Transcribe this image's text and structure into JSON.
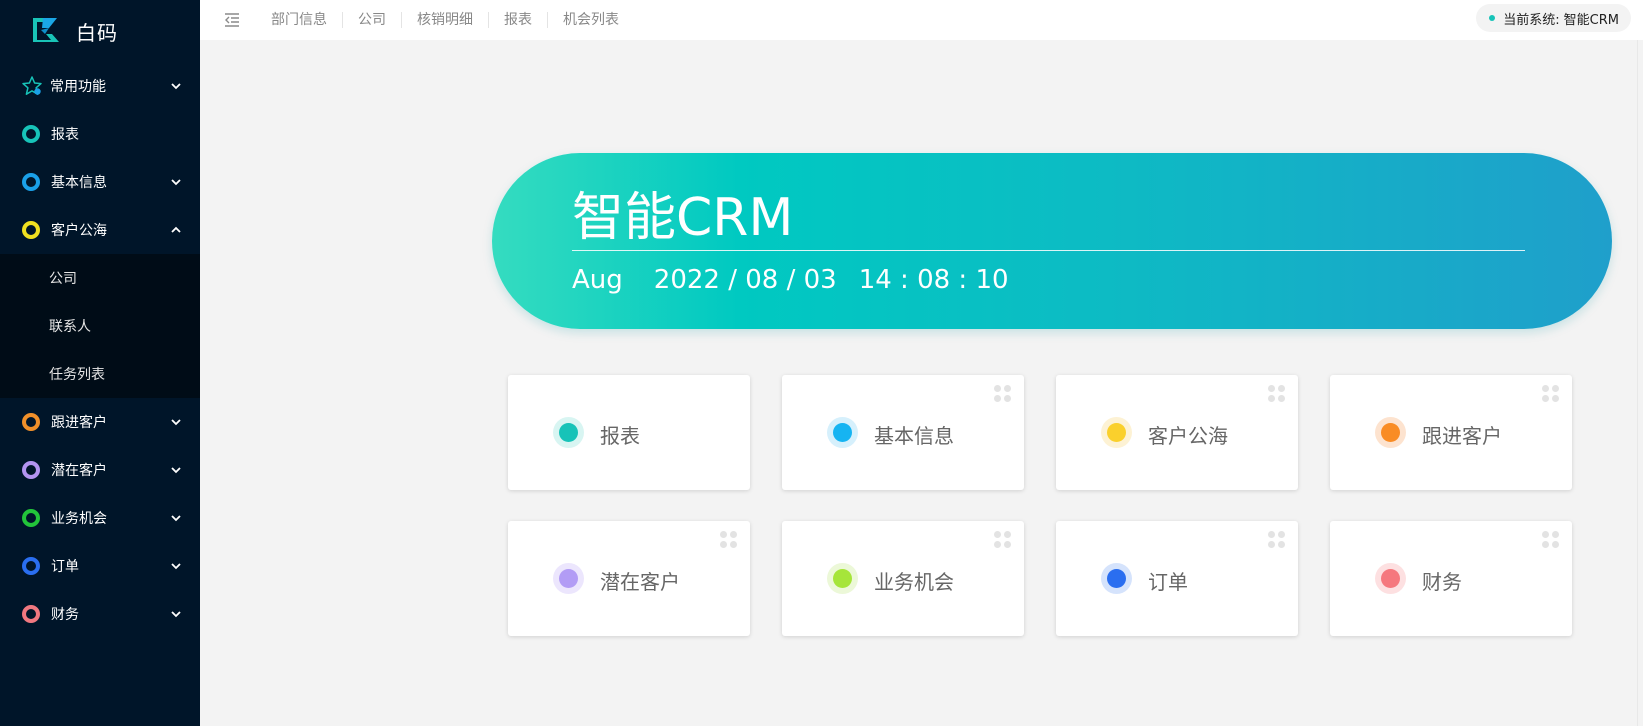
{
  "brand": {
    "name": "白码"
  },
  "sidebar": {
    "items": [
      {
        "label": "常用功能",
        "icon": "star-icon",
        "color": "#17c3b8",
        "expandable": true,
        "expanded": false
      },
      {
        "label": "报表",
        "icon": "ring-icon",
        "color": "#17c3b8",
        "expandable": false
      },
      {
        "label": "基本信息",
        "icon": "ring-icon",
        "color": "#1aa0e8",
        "expandable": true,
        "expanded": false
      },
      {
        "label": "客户公海",
        "icon": "ring-icon",
        "color": "#f0e020",
        "expandable": true,
        "expanded": true,
        "children": [
          "公司",
          "联系人",
          "任务列表"
        ]
      },
      {
        "label": "跟进客户",
        "icon": "ring-icon",
        "color": "#f0902a",
        "expandable": true,
        "expanded": false
      },
      {
        "label": "潜在客户",
        "icon": "ring-icon",
        "color": "#b394f0",
        "expandable": true,
        "expanded": false
      },
      {
        "label": "业务机会",
        "icon": "ring-icon",
        "color": "#22c43a",
        "expandable": true,
        "expanded": false
      },
      {
        "label": "订单",
        "icon": "ring-icon",
        "color": "#2a6ef0",
        "expandable": true,
        "expanded": false
      },
      {
        "label": "财务",
        "icon": "ring-icon",
        "color": "#f07880",
        "expandable": true,
        "expanded": false
      }
    ]
  },
  "topbar": {
    "tabs": [
      "部门信息",
      "公司",
      "核销明细",
      "报表",
      "机会列表"
    ],
    "system_label": "当前系统:",
    "system_name": "智能CRM"
  },
  "hero": {
    "title": "智能CRM",
    "month": "Aug",
    "date": "2022 / 08 / 03",
    "time": "14 : 08 : 10"
  },
  "cards": [
    {
      "label": "报表",
      "color": "#17c3b8",
      "halo": "#d8f5f2",
      "draggable": false
    },
    {
      "label": "基本信息",
      "color": "#16b4f2",
      "halo": "#d6f0fc",
      "draggable": true
    },
    {
      "label": "客户公海",
      "color": "#fad02c",
      "halo": "#fdf2d4",
      "draggable": true
    },
    {
      "label": "跟进客户",
      "color": "#f98c24",
      "halo": "#fde3cf",
      "draggable": true
    },
    {
      "label": "潜在客户",
      "color": "#b29cf5",
      "halo": "#ece6fd",
      "draggable": true
    },
    {
      "label": "业务机会",
      "color": "#a6e53a",
      "halo": "#ecf8d8",
      "draggable": true
    },
    {
      "label": "订单",
      "color": "#2a6ef0",
      "halo": "#d5e3fc",
      "draggable": true
    },
    {
      "label": "财务",
      "color": "#f5787e",
      "halo": "#fde0e1",
      "draggable": true
    }
  ]
}
